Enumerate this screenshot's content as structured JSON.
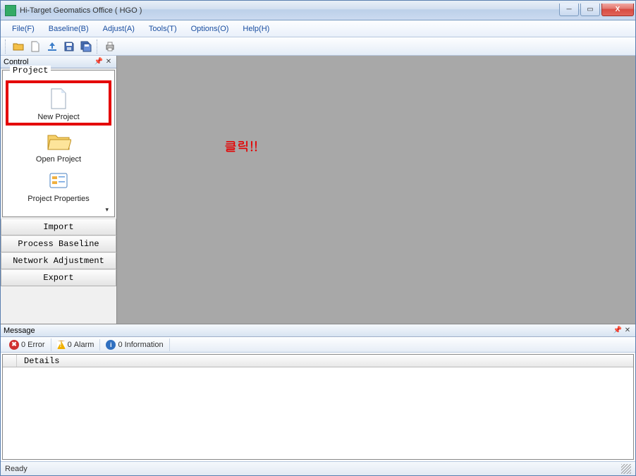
{
  "window": {
    "title": "Hi-Target Geomatics Office ( HGO )"
  },
  "menu": {
    "file": "File(F)",
    "baseline": "Baseline(B)",
    "adjust": "Adjust(A)",
    "tools": "Tools(T)",
    "options": "Options(O)",
    "help": "Help(H)"
  },
  "sidebar": {
    "panel_title": "Control",
    "group_label": "Project",
    "items": {
      "new_project": "New Project",
      "open_project": "Open Project",
      "project_properties": "Project Properties"
    },
    "buttons": {
      "import": "Import",
      "process_baseline": "Process Baseline",
      "network_adjustment": "Network Adjustment",
      "export": "Export"
    }
  },
  "annotation": {
    "text": "클릭!!",
    "color": "#e40000"
  },
  "message": {
    "panel_title": "Message",
    "filters": {
      "error_count": "0",
      "error_label": "Error",
      "alarm_count": "0",
      "alarm_label": "Alarm",
      "info_count": "0",
      "info_label": "Information"
    },
    "details_header": "Details"
  },
  "status": {
    "text": "Ready"
  },
  "icons": {
    "open": "open-folder-icon",
    "new": "new-file-icon",
    "import": "import-icon",
    "save": "save-icon",
    "saveall": "save-all-icon",
    "print": "print-icon"
  }
}
